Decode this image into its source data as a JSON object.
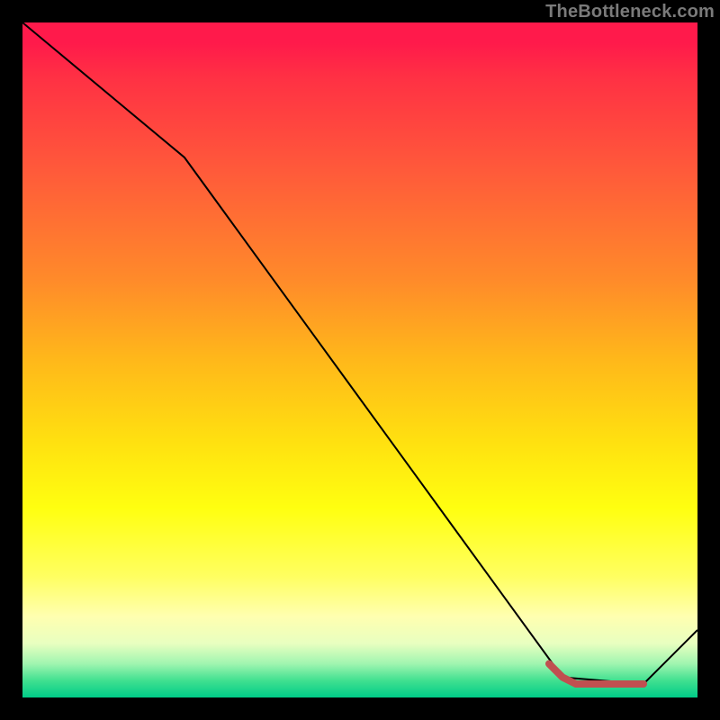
{
  "watermark": "TheBottleneck.com",
  "chart_data": {
    "type": "line",
    "title": "",
    "xlabel": "",
    "ylabel": "",
    "xlim": [
      0,
      100
    ],
    "ylim": [
      0,
      100
    ],
    "grid": false,
    "legend": false,
    "background_gradient": "red-to-green vertical",
    "series": [
      {
        "name": "bottleneck-curve",
        "color": "#000000",
        "stroke_width": 2,
        "x": [
          0,
          24,
          80,
          92,
          100
        ],
        "values": [
          100,
          80,
          3,
          2,
          10
        ]
      },
      {
        "name": "optimal-segment",
        "color": "#c05050",
        "stroke_width": 8,
        "linecap": "round",
        "x": [
          78,
          80,
          82,
          92
        ],
        "values": [
          5,
          3,
          2,
          2
        ]
      }
    ]
  }
}
